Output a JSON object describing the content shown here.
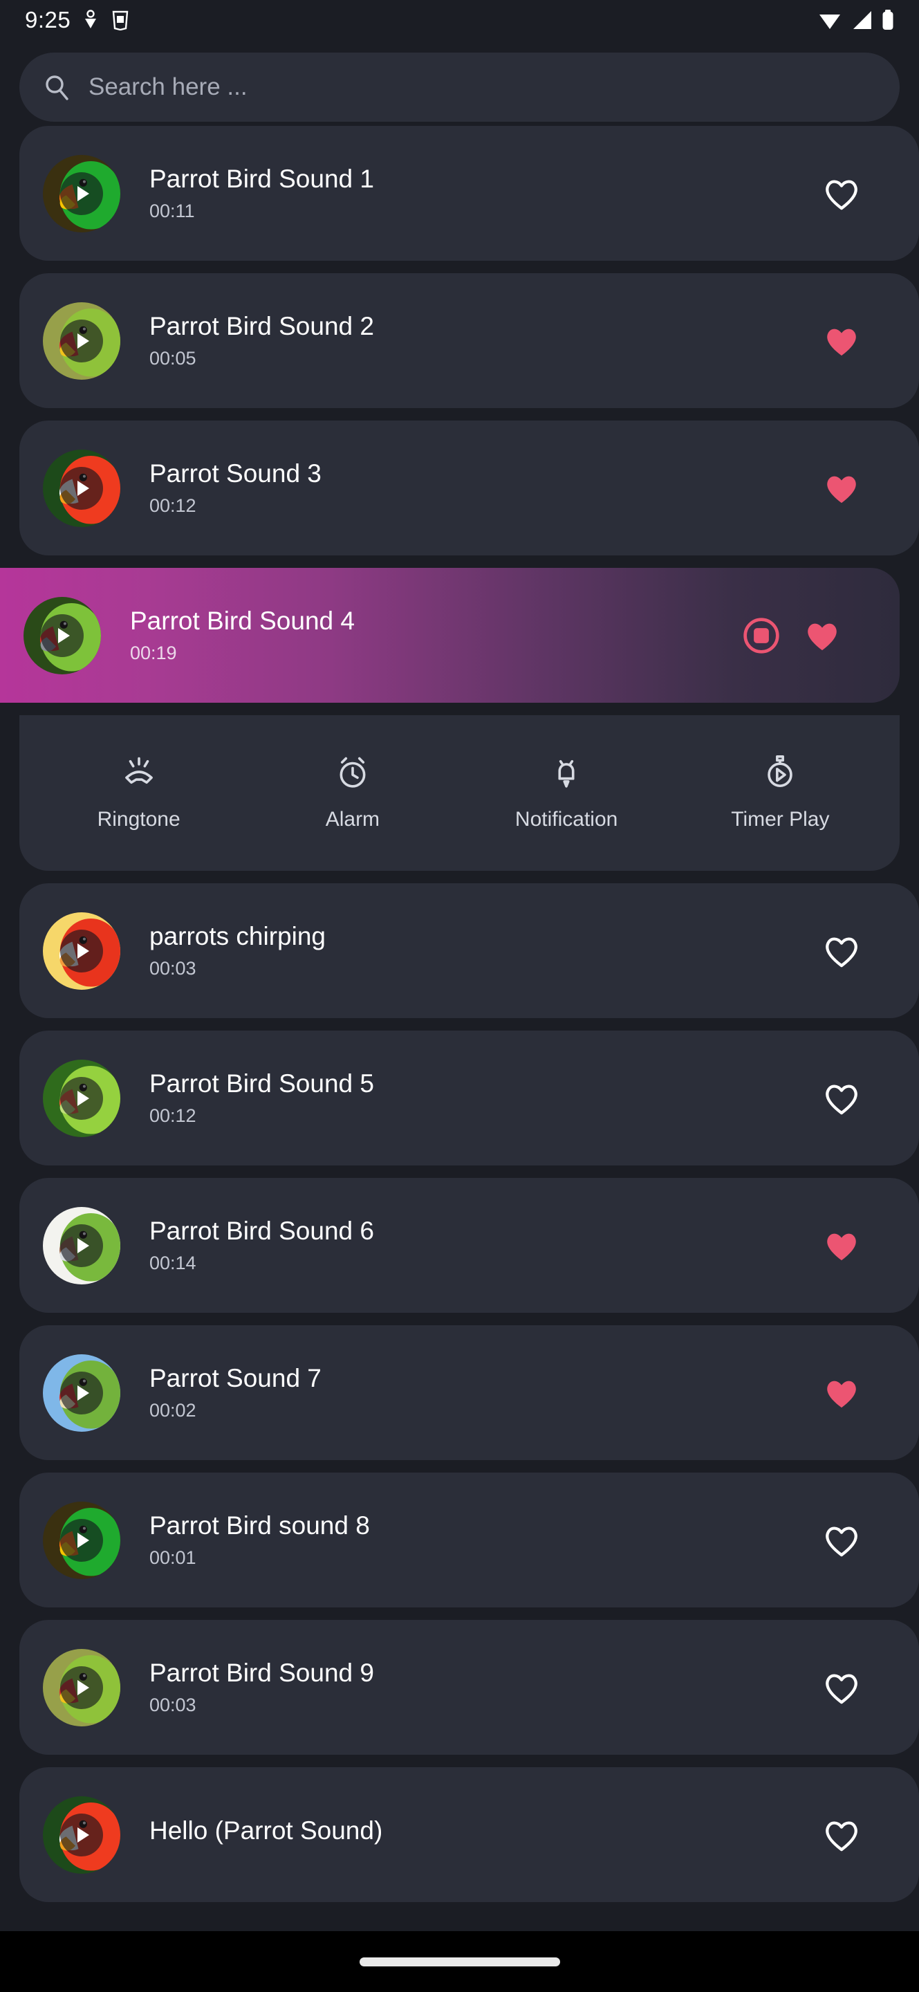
{
  "status_bar": {
    "time": "9:25",
    "left_icons": [
      "download-arrow-icon",
      "vpn-key-icon"
    ],
    "right_icons": [
      "wifi-icon",
      "cellular-signal-icon",
      "battery-icon"
    ]
  },
  "search": {
    "placeholder": "Search here ...",
    "value": "",
    "icon": "search-icon"
  },
  "colors": {
    "page_background": "#1b1d24",
    "card_background": "#2b2e39",
    "accent_pink": "#ec5572",
    "selected_gradient_start": "#b7359b",
    "selected_gradient_end": "#2e2b3c",
    "text_primary": "#ffffff",
    "text_secondary": "#c3c7d2"
  },
  "option_panel": {
    "visible_for_item_index": 3,
    "options": [
      {
        "label": "Ringtone",
        "icon": "ringtone-icon"
      },
      {
        "label": "Alarm",
        "icon": "alarm-clock-icon"
      },
      {
        "label": "Notification",
        "icon": "notification-bell-icon"
      },
      {
        "label": "Timer Play",
        "icon": "timer-play-icon"
      }
    ]
  },
  "sounds": [
    {
      "title": "Parrot Bird Sound 1",
      "duration": "00:11",
      "favorite": false,
      "playing": false,
      "thumb": {
        "bird": "green-eclectus-parrot",
        "bg": "#3a3010",
        "body": "#1faa2e",
        "accent": "#f4720d",
        "accent2": "#f7c400"
      }
    },
    {
      "title": "Parrot Bird Sound 2",
      "duration": "00:05",
      "favorite": true,
      "playing": false,
      "thumb": {
        "bird": "green-amazon-parrot",
        "bg": "#97a04a",
        "body": "#8fc23a",
        "accent": "#d8342a",
        "accent2": "#f2c21b"
      }
    },
    {
      "title": "Parrot Sound 3",
      "duration": "00:12",
      "favorite": true,
      "playing": false,
      "thumb": {
        "bird": "scarlet-macaw",
        "bg": "#1d4a1a",
        "body": "#ef3b1f",
        "accent": "#ffffff",
        "accent2": "#f4a01c"
      }
    },
    {
      "title": "Parrot Bird Sound 4",
      "duration": "00:19",
      "favorite": true,
      "playing": true,
      "thumb": {
        "bird": "red-crowned-amazon",
        "bg": "#2a4a18",
        "body": "#7ec23a",
        "accent": "#d8342a",
        "accent2": "#8d9199"
      }
    },
    {
      "title": "parrots chirping",
      "duration": "00:03",
      "favorite": false,
      "playing": false,
      "thumb": {
        "bird": "scarlet-macaw-closeup",
        "bg": "#f6d76a",
        "body": "#e8341d",
        "accent": "#ffffff",
        "accent2": "#f59b3b"
      }
    },
    {
      "title": "Parrot Bird Sound 5",
      "duration": "00:12",
      "favorite": false,
      "playing": false,
      "thumb": {
        "bird": "rose-ringed-parakeet",
        "bg": "#2f6b1c",
        "body": "#95d13f",
        "accent": "#ef5c36",
        "accent2": "#bfe07a"
      }
    },
    {
      "title": "Parrot Bird Sound 6",
      "duration": "00:14",
      "favorite": true,
      "playing": false,
      "thumb": {
        "bird": "monk-parakeet",
        "bg": "#f3f3ef",
        "body": "#79b93d",
        "accent": "#9b6a4e",
        "accent2": "#d9dde2"
      }
    },
    {
      "title": "Parrot Sound 7",
      "duration": "00:02",
      "favorite": true,
      "playing": false,
      "thumb": {
        "bird": "military-macaw",
        "bg": "#7fb7e8",
        "body": "#73b23c",
        "accent": "#d8342a",
        "accent2": "#efe0b4"
      }
    },
    {
      "title": "Parrot Bird sound 8",
      "duration": "00:01",
      "favorite": false,
      "playing": false,
      "thumb": {
        "bird": "green-eclectus-parrot",
        "bg": "#3a3010",
        "body": "#1faa2e",
        "accent": "#f4720d",
        "accent2": "#f7c400"
      }
    },
    {
      "title": "Parrot Bird Sound 9",
      "duration": "00:03",
      "favorite": false,
      "playing": false,
      "thumb": {
        "bird": "green-amazon-parrot",
        "bg": "#97a04a",
        "body": "#8fc23a",
        "accent": "#d8342a",
        "accent2": "#f2c21b"
      }
    },
    {
      "title": "Hello (Parrot Sound)",
      "duration": "",
      "favorite": false,
      "playing": false,
      "thumb": {
        "bird": "scarlet-macaw",
        "bg": "#1d4a1a",
        "body": "#ef3b1f",
        "accent": "#ffffff",
        "accent2": "#f4a01c"
      }
    }
  ],
  "nav_bar": {
    "gesture_pill": "home-gesture-pill"
  }
}
